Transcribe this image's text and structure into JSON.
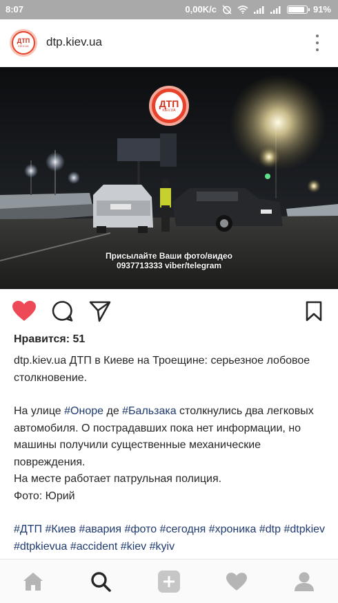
{
  "status_bar": {
    "time": "8:07",
    "network_speed": "0,00K/c",
    "battery_percent": "91%",
    "battery_level": 0.91
  },
  "post": {
    "username": "dtp.kiev.ua",
    "avatar_text": "ДТП",
    "avatar_sub": "KIEV.UA",
    "photo": {
      "logo_text": "ДТП",
      "logo_sub": "KIEV.UA",
      "watermark_line1": "Присылайте Ваши фото/видео",
      "watermark_line2": "0937713333 viber/telegram"
    },
    "likes_text": "Нравится: 51",
    "caption": {
      "username": "dtp.kiev.ua",
      "title": " ДТП в Киеве на Троещине: серьезное лобовое столкновение.",
      "p2_part1": "На улице ",
      "p2_tag1": "#Оноре",
      "p2_part2": " де ",
      "p2_tag2": "#Бальзака",
      "p2_part3": " столкнулись два легковых автомобиля. О пострадавших пока нет информации, но машины получили существенные механические повреждения.",
      "p3": "На месте работает патрульная полиция.",
      "p4": "Фото: Юрий",
      "hashtags": [
        "#ДТП",
        "#Киев",
        "#авария",
        "#фото",
        "#сегодня",
        "#хроника",
        "#dtp",
        "#dtpkiev",
        "#dtpkievua",
        "#accident",
        "#kiev",
        "#kyiv"
      ]
    }
  },
  "icons": {
    "like": "heart-icon",
    "comment": "comment-icon",
    "share": "send-icon",
    "save": "bookmark-icon",
    "nav": [
      "home-icon",
      "search-icon",
      "add-post-icon",
      "activity-heart-icon",
      "profile-icon"
    ]
  },
  "colors": {
    "like_red": "#ed4956",
    "hashtag_blue": "#1f3a70",
    "status_bar_gray": "#a9a9a9"
  }
}
